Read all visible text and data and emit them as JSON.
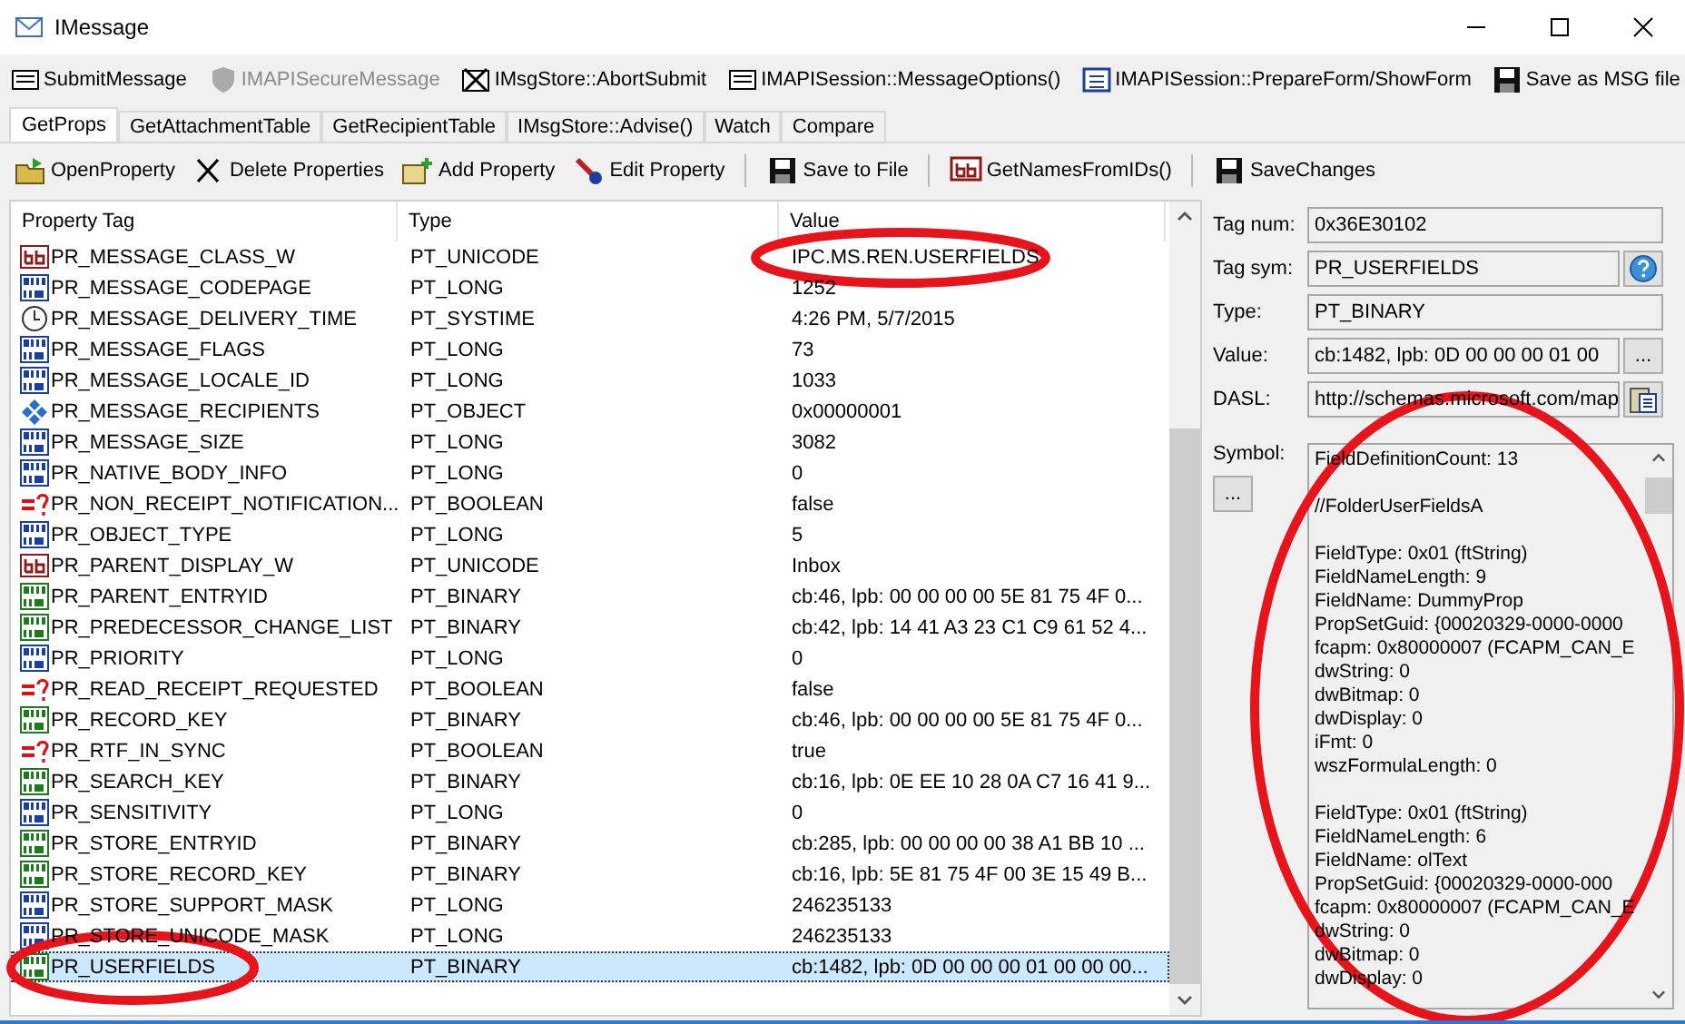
{
  "window": {
    "title": "IMessage"
  },
  "toolbar": [
    {
      "label": "SubmitMessage",
      "disabled": false
    },
    {
      "label": "IMAPISecureMessage",
      "disabled": true
    },
    {
      "label": "IMsgStore::AbortSubmit",
      "disabled": false
    },
    {
      "label": "IMAPISession::MessageOptions()",
      "disabled": false
    },
    {
      "label": "IMAPISession::PrepareForm/ShowForm",
      "disabled": false
    },
    {
      "label": "Save as MSG file",
      "disabled": false
    }
  ],
  "tabs": [
    {
      "label": "GetProps",
      "selected": true
    },
    {
      "label": "GetAttachmentTable",
      "selected": false
    },
    {
      "label": "GetRecipientTable",
      "selected": false
    },
    {
      "label": "IMsgStore::Advise()",
      "selected": false
    },
    {
      "label": "Watch",
      "selected": false
    },
    {
      "label": "Compare",
      "selected": false
    }
  ],
  "prop_toolbar": [
    [
      "OpenProperty",
      "Delete Properties",
      "Add Property",
      "Edit Property"
    ],
    [
      "Save to File"
    ],
    [
      "GetNamesFromIDs()"
    ],
    [
      "SaveChanges"
    ]
  ],
  "table": {
    "columns": [
      "Property Tag",
      "Type",
      "Value"
    ],
    "rows": [
      {
        "tag": "PR_MESSAGE_CLASS_W",
        "type": "PT_UNICODE",
        "value": "IPC.MS.REN.USERFIELDS",
        "kind": "string",
        "selected": false
      },
      {
        "tag": "PR_MESSAGE_CODEPAGE",
        "type": "PT_LONG",
        "value": "1252",
        "kind": "long",
        "selected": false
      },
      {
        "tag": "PR_MESSAGE_DELIVERY_TIME",
        "type": "PT_SYSTIME",
        "value": "4:26 PM, 5/7/2015",
        "kind": "time",
        "selected": false
      },
      {
        "tag": "PR_MESSAGE_FLAGS",
        "type": "PT_LONG",
        "value": "73",
        "kind": "long",
        "selected": false
      },
      {
        "tag": "PR_MESSAGE_LOCALE_ID",
        "type": "PT_LONG",
        "value": "1033",
        "kind": "long",
        "selected": false
      },
      {
        "tag": "PR_MESSAGE_RECIPIENTS",
        "type": "PT_OBJECT",
        "value": "0x00000001",
        "kind": "object",
        "selected": false
      },
      {
        "tag": "PR_MESSAGE_SIZE",
        "type": "PT_LONG",
        "value": "3082",
        "kind": "long",
        "selected": false
      },
      {
        "tag": "PR_NATIVE_BODY_INFO",
        "type": "PT_LONG",
        "value": "0",
        "kind": "long",
        "selected": false
      },
      {
        "tag": "PR_NON_RECEIPT_NOTIFICATION...",
        "type": "PT_BOOLEAN",
        "value": "false",
        "kind": "bool",
        "selected": false
      },
      {
        "tag": "PR_OBJECT_TYPE",
        "type": "PT_LONG",
        "value": "5",
        "kind": "long",
        "selected": false
      },
      {
        "tag": "PR_PARENT_DISPLAY_W",
        "type": "PT_UNICODE",
        "value": "Inbox",
        "kind": "string",
        "selected": false
      },
      {
        "tag": "PR_PARENT_ENTRYID",
        "type": "PT_BINARY",
        "value": "cb:46, lpb: 00 00 00 00 5E 81 75 4F 0...",
        "kind": "binary",
        "selected": false
      },
      {
        "tag": "PR_PREDECESSOR_CHANGE_LIST",
        "type": "PT_BINARY",
        "value": "cb:42, lpb: 14 41 A3 23 C1 C9 61 52 4...",
        "kind": "binary",
        "selected": false
      },
      {
        "tag": "PR_PRIORITY",
        "type": "PT_LONG",
        "value": "0",
        "kind": "long",
        "selected": false
      },
      {
        "tag": "PR_READ_RECEIPT_REQUESTED",
        "type": "PT_BOOLEAN",
        "value": "false",
        "kind": "bool",
        "selected": false
      },
      {
        "tag": "PR_RECORD_KEY",
        "type": "PT_BINARY",
        "value": "cb:46, lpb: 00 00 00 00 5E 81 75 4F 0...",
        "kind": "binary",
        "selected": false
      },
      {
        "tag": "PR_RTF_IN_SYNC",
        "type": "PT_BOOLEAN",
        "value": "true",
        "kind": "bool",
        "selected": false
      },
      {
        "tag": "PR_SEARCH_KEY",
        "type": "PT_BINARY",
        "value": "cb:16, lpb: 0E EE 10 28 0A C7 16 41 9...",
        "kind": "binary",
        "selected": false
      },
      {
        "tag": "PR_SENSITIVITY",
        "type": "PT_LONG",
        "value": "0",
        "kind": "long",
        "selected": false
      },
      {
        "tag": "PR_STORE_ENTRYID",
        "type": "PT_BINARY",
        "value": "cb:285, lpb: 00 00 00 00 38 A1 BB 10 ...",
        "kind": "binary",
        "selected": false
      },
      {
        "tag": "PR_STORE_RECORD_KEY",
        "type": "PT_BINARY",
        "value": "cb:16, lpb: 5E 81 75 4F 00 3E 15 49 B...",
        "kind": "binary",
        "selected": false
      },
      {
        "tag": "PR_STORE_SUPPORT_MASK",
        "type": "PT_LONG",
        "value": "246235133",
        "kind": "long",
        "selected": false
      },
      {
        "tag": "PR_STORE_UNICODE_MASK",
        "type": "PT_LONG",
        "value": "246235133",
        "kind": "long",
        "selected": false
      },
      {
        "tag": "PR_USERFIELDS",
        "type": "PT_BINARY",
        "value": "cb:1482, lpb: 0D 00 00 00 01 00 00 00...",
        "kind": "binary",
        "selected": true
      }
    ]
  },
  "details": {
    "fields": [
      {
        "label": "Tag num:",
        "value": "0x36E30102"
      },
      {
        "label": "Tag sym:",
        "value": "PR_USERFIELDS"
      },
      {
        "label": "Type:",
        "value": "PT_BINARY"
      },
      {
        "label": "Value:",
        "value": "cb:1482, lpb: 0D 00 00 00 01 00"
      },
      {
        "label": "DASL:",
        "value": "http://schemas.microsoft.com/map"
      }
    ],
    "symbol_label": "Symbol:",
    "symbol_button": "...",
    "value_button": "...",
    "symbol_blocks": [
      [
        "FieldDefinitionCount: 13"
      ],
      [
        "//FolderUserFieldsA"
      ],
      [
        "FieldType: 0x01 (ftString)",
        "FieldNameLength: 9",
        "FieldName: DummyProp",
        "PropSetGuid: {00020329-0000-0000",
        "fcapm: 0x80000007 (FCAPM_CAN_E",
        "dwString: 0",
        "dwBitmap: 0",
        "dwDisplay: 0",
        "iFmt: 0",
        "wszFormulaLength: 0"
      ],
      [
        "FieldType: 0x01 (ftString)",
        "FieldNameLength: 6",
        "FieldName: olText",
        "PropSetGuid: {00020329-0000-000",
        "fcapm: 0x80000007 (FCAPM_CAN_E",
        "dwString: 0",
        "dwBitmap: 0",
        "dwDisplay: 0"
      ]
    ]
  }
}
